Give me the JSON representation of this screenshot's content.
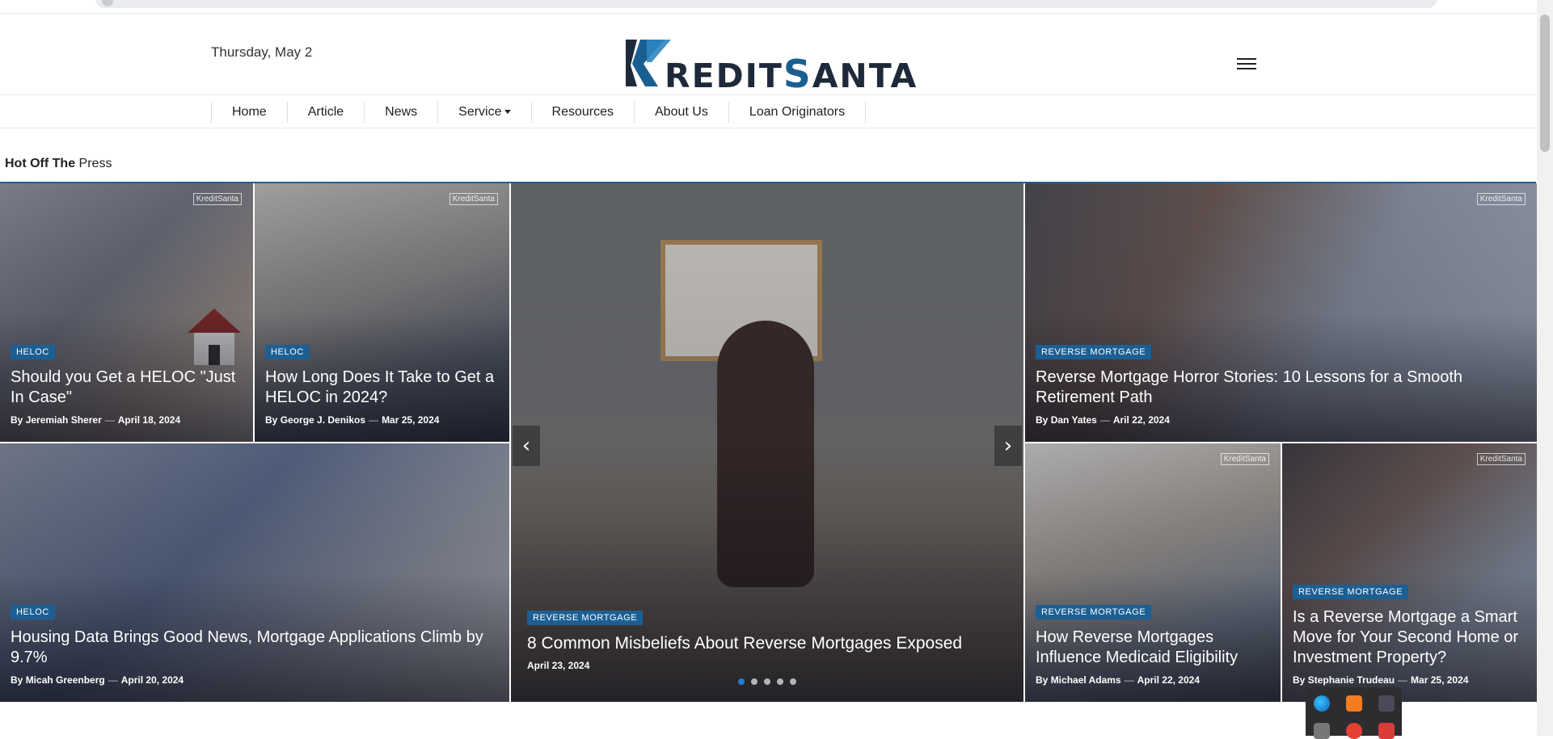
{
  "header": {
    "date": "Thursday, May 2",
    "logo_text_pre": "REDIT",
    "logo_text_s": "S",
    "logo_text_post": "ANTA"
  },
  "nav": {
    "items": [
      {
        "label": "Home"
      },
      {
        "label": "Article"
      },
      {
        "label": "News"
      },
      {
        "label": "Service"
      },
      {
        "label": "Resources"
      },
      {
        "label": "About Us"
      },
      {
        "label": "Loan Originators"
      }
    ]
  },
  "section": {
    "title_bold": "Hot Off The",
    "title_rest": "Press"
  },
  "watermark": "KreditSanta",
  "cards": [
    {
      "category": "HELOC",
      "title": "Should you Get a HELOC \"Just In Case\"",
      "author": "Jeremiah Sherer",
      "date": "April 18, 2024"
    },
    {
      "category": "HELOC",
      "title": "How Long Does It Take to Get a HELOC in 2024?",
      "author": "George J. Denikos",
      "date": "Mar 25, 2024"
    },
    {
      "category": "REVERSE MORTGAGE",
      "title": "8 Common Misbeliefs About Reverse Mortgages Exposed",
      "date": "April 23, 2024"
    },
    {
      "category": "REVERSE MORTGAGE",
      "title": "Reverse Mortgage Horror Stories: 10 Lessons for a Smooth Retirement Path",
      "author": "Dan Yates",
      "date": "Aril 22, 2024"
    },
    {
      "category": "HELOC",
      "title": "Housing Data Brings Good News, Mortgage Applications Climb by 9.7%",
      "author": "Micah Greenberg",
      "date": "April 20, 2024"
    },
    {
      "category": "REVERSE MORTGAGE",
      "title": "How Reverse Mortgages Influence Medicaid Eligibility",
      "author": "Michael Adams",
      "date": "April 22, 2024"
    },
    {
      "category": "REVERSE MORTGAGE",
      "title": "Is a Reverse Mortgage a Smart Move for Your Second Home or Investment Property?",
      "author": "Stephanie Trudeau",
      "date": "Mar 25, 2024"
    }
  ],
  "byline": {
    "prefix": "By",
    "sep": "—"
  },
  "slider": {
    "prev": "‹",
    "next": "›",
    "slides": 5,
    "active": 1
  },
  "colors": {
    "accent": "#1c5f93",
    "divider": "#1e5f99"
  }
}
